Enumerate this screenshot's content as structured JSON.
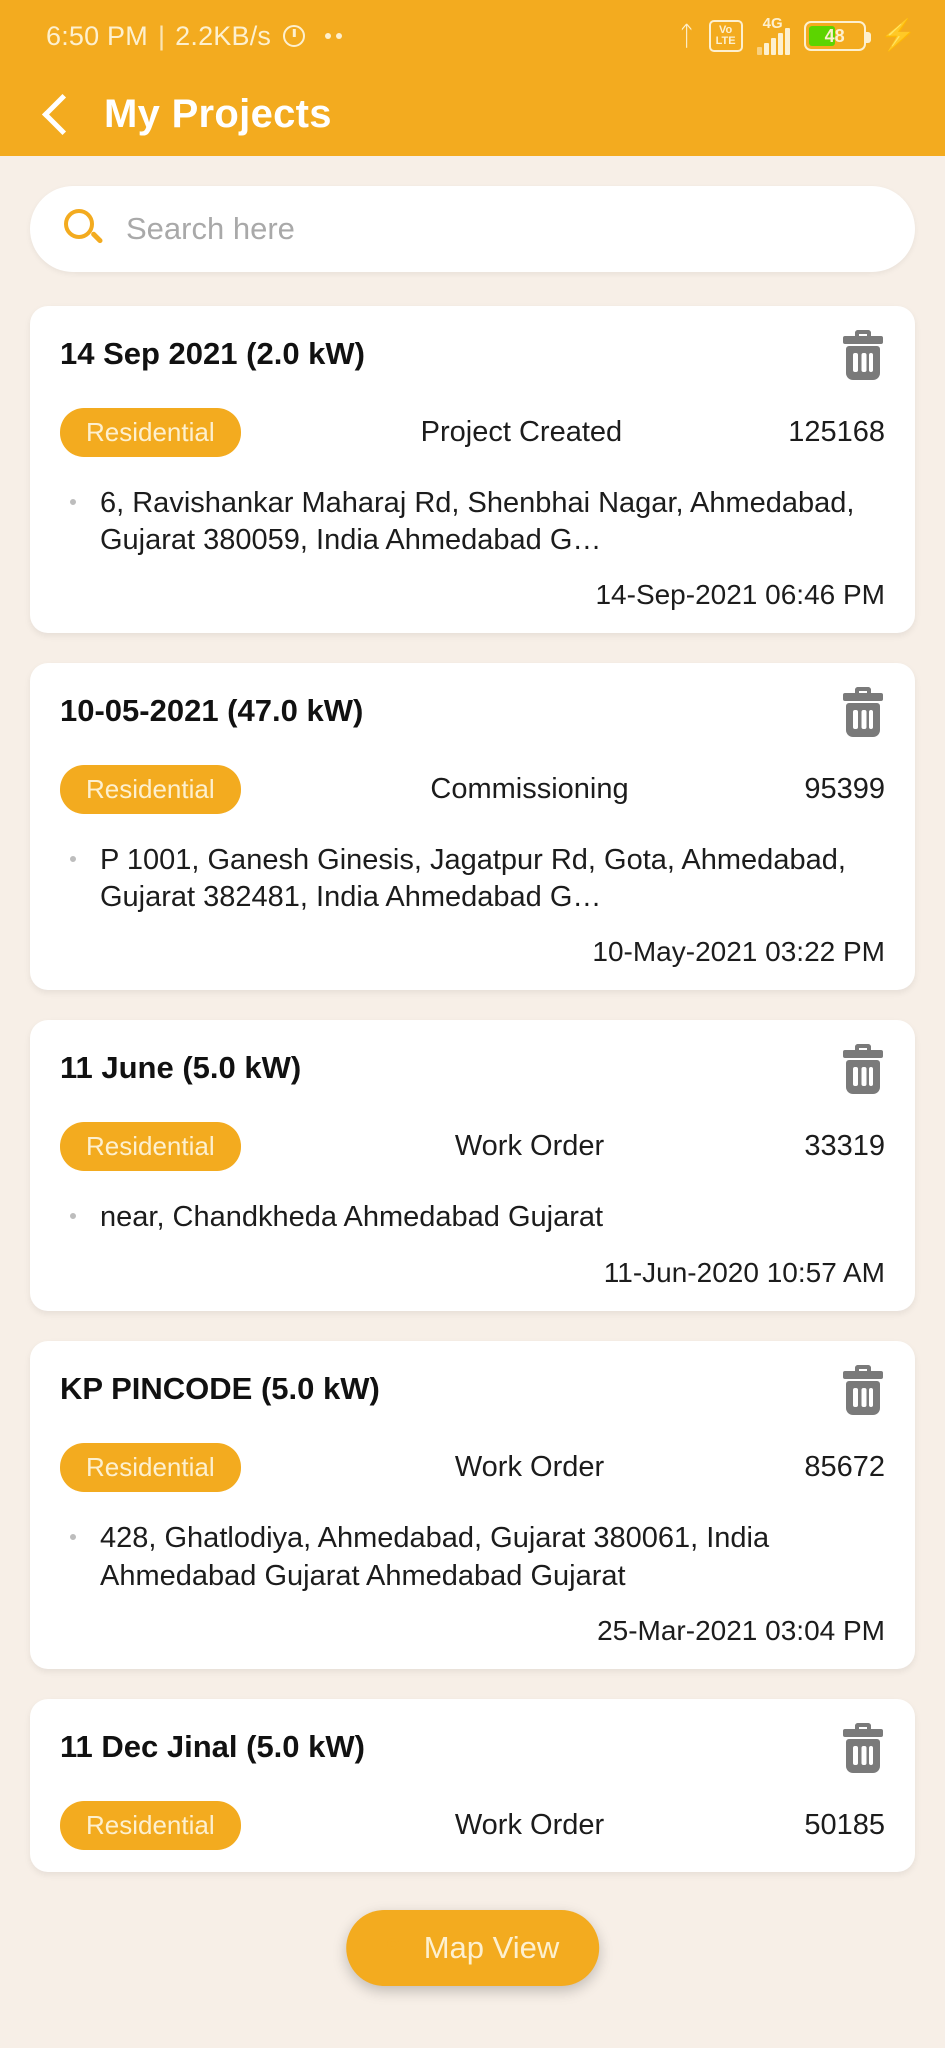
{
  "statusbar": {
    "time": "6:50 PM",
    "separator": "|",
    "network_speed": "2.2KB/s",
    "alarm_icon": "alarm-icon",
    "more_dots": "more-dots",
    "bluetooth_icon": "bluetooth-icon",
    "volte_top": "Vo",
    "volte_bottom": "LTE",
    "network_generation": "4G",
    "battery_percent": "48",
    "charging_icon": "charging-bolt-icon"
  },
  "appbar": {
    "back_icon": "back-chevron-icon",
    "title": "My Projects"
  },
  "search": {
    "icon": "search-icon",
    "placeholder": "Search here",
    "value": ""
  },
  "colors": {
    "brand": "#f3ab1f",
    "page_bg": "#f7efe7",
    "card_bg": "#ffffff",
    "badge_text": "#fdf0cf",
    "battery_fill": "#5cd400"
  },
  "fab": {
    "icon": "map-pin-icon",
    "label": "Map View"
  },
  "projects": [
    {
      "title": "14 Sep 2021 (2.0 kW)",
      "badge": "Residential",
      "status": "Project Created",
      "id": "125168",
      "address": "6, Ravishankar Maharaj Rd, Shenbhai Nagar, Ahmedabad, Gujarat 380059, India Ahmedabad G…",
      "timestamp": "14-Sep-2021 06:46 PM",
      "delete_icon": "trash-icon",
      "location_icon": "location-pin-icon"
    },
    {
      "title": "10-05-2021 (47.0 kW)",
      "badge": "Residential",
      "status": "Commissioning",
      "id": "95399",
      "address": "P 1001, Ganesh Ginesis, Jagatpur Rd, Gota, Ahmedabad, Gujarat 382481, India Ahmedabad G…",
      "timestamp": "10-May-2021 03:22 PM",
      "delete_icon": "trash-icon",
      "location_icon": "location-pin-icon"
    },
    {
      "title": "11 June (5.0 kW)",
      "badge": "Residential",
      "status": "Work Order",
      "id": "33319",
      "address": "near, Chandkheda Ahmedabad Gujarat",
      "timestamp": "11-Jun-2020 10:57 AM",
      "delete_icon": "trash-icon",
      "location_icon": "location-pin-icon"
    },
    {
      "title": "KP PINCODE (5.0 kW)",
      "badge": "Residential",
      "status": "Work Order",
      "id": "85672",
      "address": "428, Ghatlodiya, Ahmedabad, Gujarat 380061, India Ahmedabad Gujarat Ahmedabad Gujarat",
      "timestamp": "25-Mar-2021 03:04 PM",
      "delete_icon": "trash-icon",
      "location_icon": "location-pin-icon"
    },
    {
      "title": "11 Dec Jinal (5.0 kW)",
      "badge": "Residential",
      "status": "Work Order",
      "id": "50185",
      "address": "",
      "timestamp": "",
      "delete_icon": "trash-icon",
      "location_icon": "location-pin-icon"
    }
  ]
}
